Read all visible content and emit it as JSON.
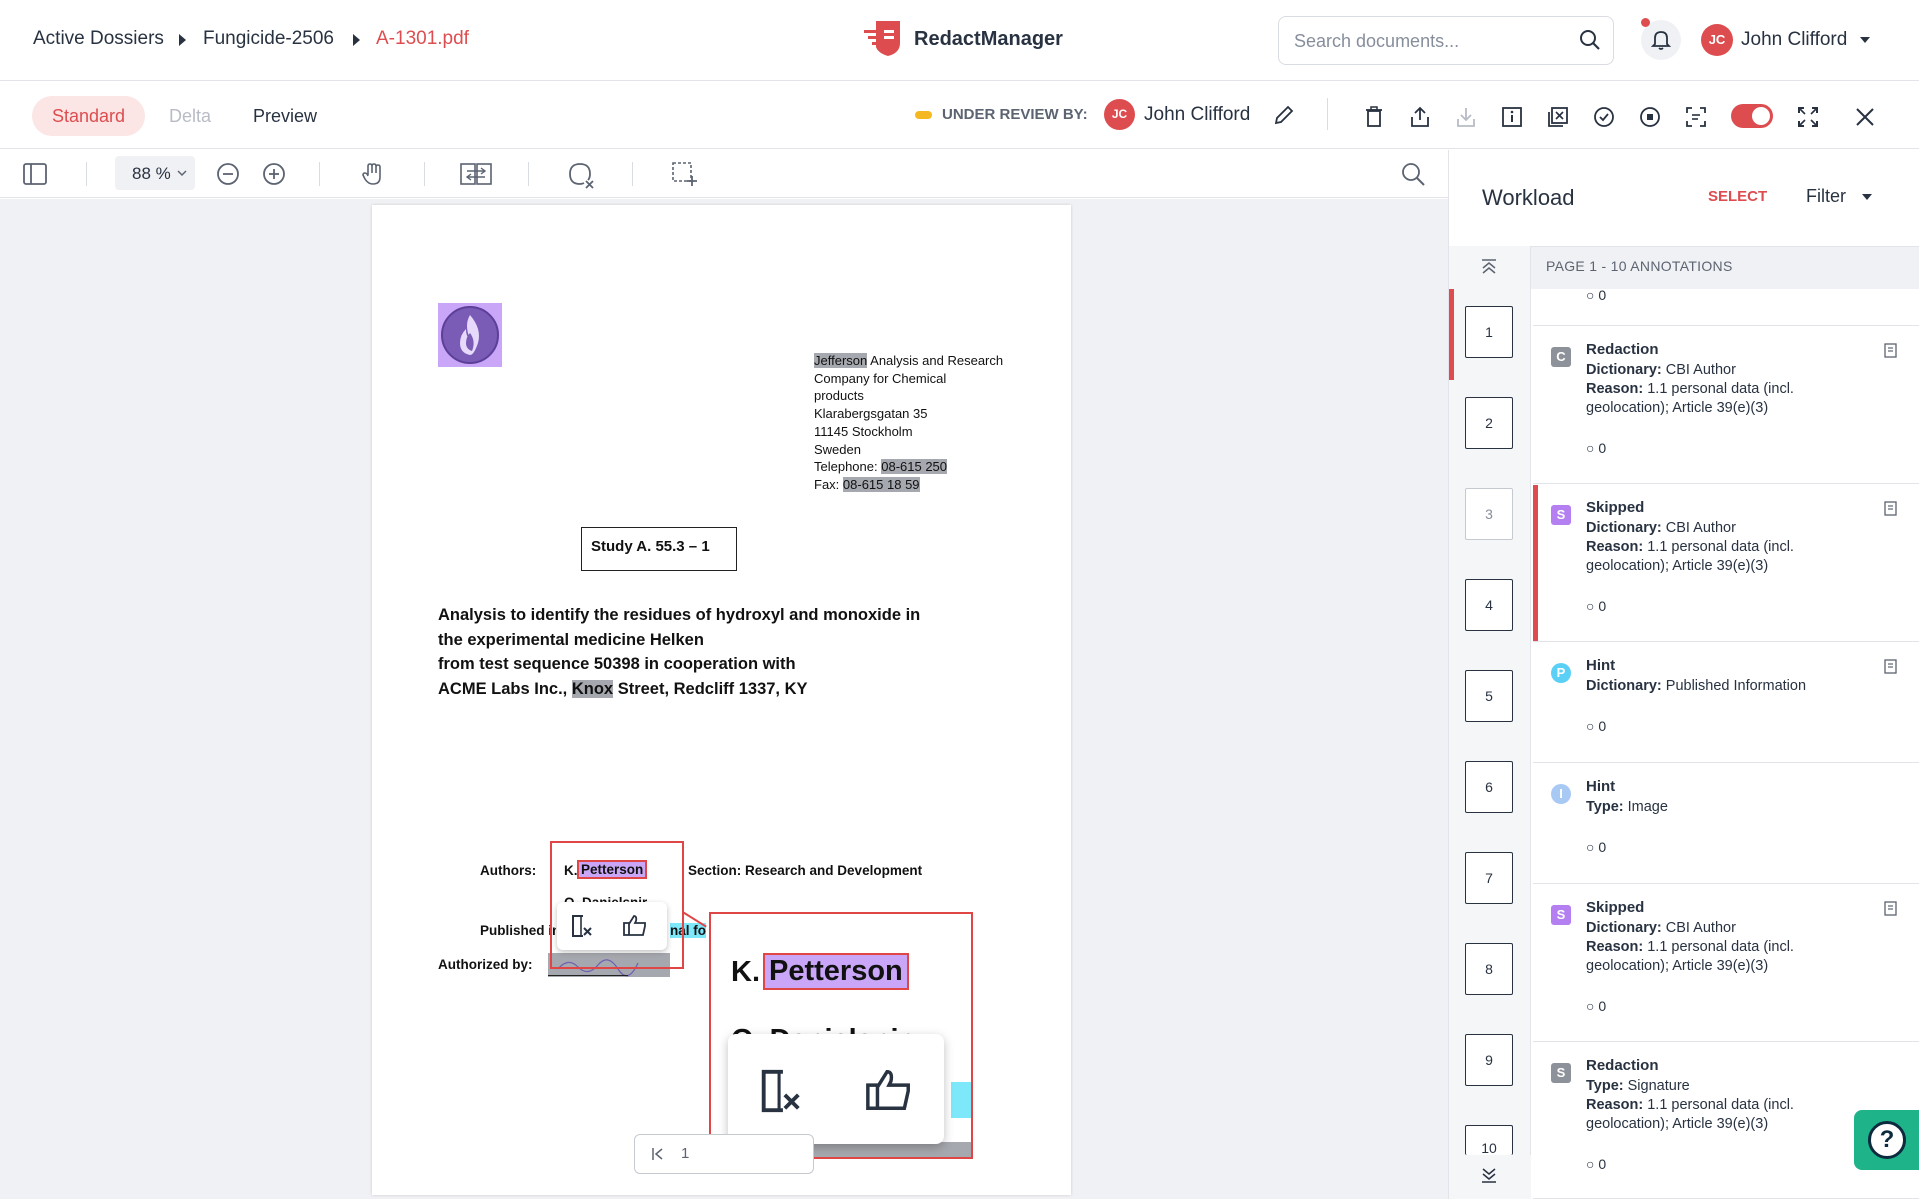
{
  "breadcrumb": {
    "item1": "Active Dossiers",
    "item2": "Fungicide-2506",
    "item3": "A-1301.pdf"
  },
  "app": {
    "name": "RedactManager"
  },
  "search": {
    "placeholder": "Search documents..."
  },
  "user": {
    "initials": "JC",
    "name": "John Clifford"
  },
  "tabs": {
    "standard": "Standard",
    "delta": "Delta",
    "preview": "Preview"
  },
  "review": {
    "label": "UNDER REVIEW BY:",
    "initials": "JC",
    "name": "John Clifford"
  },
  "viewer": {
    "zoom": "88 %"
  },
  "doc": {
    "company_name": "Jefferson",
    "company_rest": " Analysis and Research",
    "addr2": "Company for Chemical",
    "addr3": "products",
    "addr4": "Klarabergsgatan 35",
    "addr5": "11145 Stockholm",
    "addr6": "Sweden",
    "tel_label": "Telephone: ",
    "tel": "08-615 250",
    "fax_label": "Fax: ",
    "fax": "08-615 18 59",
    "study": "Study A. 55.3 – 1",
    "title1": "Analysis to identify the residues of hydroxyl and monoxide in",
    "title2": "the experimental medicine Helken",
    "title3": "from test sequence 50398 in cooperation with",
    "title4a": "ACME Labs Inc., ",
    "title4b": "Knox",
    "title4c": " Street, Redcliff 1337, KY",
    "authors_label": "Authors:",
    "author1a": "K. ",
    "author1b": "Petterson",
    "author2": "O. Danielsnir",
    "section": "Section: Research and Development",
    "published_label": "Published in",
    "published_val": "nal fo",
    "authorized_label": "Authorized by:",
    "page_current": "1"
  },
  "panel": {
    "title": "Workload",
    "select": "SELECT",
    "filter": "Filter",
    "page_header": "PAGE 1 - 10 ANNOTATIONS",
    "top_count": "0",
    "pages": [
      "1",
      "2",
      "3",
      "4",
      "5",
      "6",
      "7",
      "8",
      "9",
      "10"
    ],
    "annotations": [
      {
        "badge": "C",
        "title": "Redaction",
        "l1k": "Dictionary:",
        "l1v": " CBI Author",
        "l2k": "Reason:",
        "l2v": " 1.1 personal data (incl. geolocation); Article 39(e)(3)",
        "count": "0"
      },
      {
        "badge": "S",
        "title": "Skipped",
        "l1k": "Dictionary:",
        "l1v": " CBI Author",
        "l2k": "Reason:",
        "l2v": " 1.1 personal data (incl. geolocation); Article 39(e)(3)",
        "count": "0"
      },
      {
        "badge": "P",
        "title": "Hint",
        "l1k": "Dictionary:",
        "l1v": " Published Information",
        "count": "0"
      },
      {
        "badge": "I",
        "title": "Hint",
        "l1k": "Type:",
        "l1v": " Image",
        "count": "0"
      },
      {
        "badge": "S",
        "title": "Skipped",
        "l1k": "Dictionary:",
        "l1v": " CBI Author",
        "l2k": "Reason:",
        "l2v": " 1.1 personal data (incl. geolocation); Article 39(e)(3)",
        "count": "0"
      },
      {
        "badge": "S",
        "title": "Redaction",
        "l1k": "Type:",
        "l1v": " Signature",
        "l2k": "Reason:",
        "l2v": " 1.1 personal data (incl. geolocation); Article 39(e)(3)",
        "count": "0"
      }
    ]
  },
  "colors": {
    "accent": "#dd4d50",
    "skipped": "#b47ff0",
    "hint_p": "#5ad0f7",
    "hint_i": "#a9c9f5",
    "redaction": "#8d9199"
  },
  "help": {
    "label": "?"
  }
}
